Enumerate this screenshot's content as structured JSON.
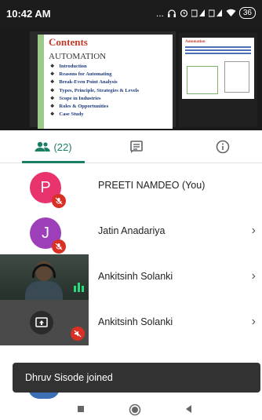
{
  "status_bar": {
    "time": "10:42 AM",
    "indicators": "...",
    "battery": "36"
  },
  "shared_screen": {
    "slide_title": "Contents",
    "slide_subtitle": "AUTOMATION",
    "slide_items": [
      "Introduction",
      "Reasons for Automating",
      "Break-Even Point Analysis",
      "Types, Principle, Strategies & Levels",
      "Scope in Industries",
      "Roles & Opportunities",
      "Case Study"
    ],
    "thumb_title": "Automation"
  },
  "tabs": {
    "people_count": "(22)"
  },
  "participants": [
    {
      "name": "PREETI NAMDEO (You)",
      "initial": "P",
      "avatar_color": "#e8336d",
      "muted": true,
      "chevron": ""
    },
    {
      "name": "Jatin Anadariya",
      "initial": "J",
      "avatar_color": "#9c3fb8",
      "muted": true,
      "chevron": "›"
    },
    {
      "name": "Ankitsinh Solanki",
      "chevron": "›"
    },
    {
      "name": "Ankitsinh Solanki",
      "chevron": "›"
    }
  ],
  "toast": {
    "message": "Dhruv Sisode joined"
  },
  "colors": {
    "accent": "#1a7f64",
    "mute_red": "#d93025"
  },
  "icons": [
    "people-icon",
    "chat-icon",
    "info-icon",
    "mic-off-icon",
    "present-screen-icon",
    "speaking-icon",
    "chevron-right-icon",
    "nav-recents-icon",
    "nav-home-icon",
    "nav-back-icon"
  ]
}
